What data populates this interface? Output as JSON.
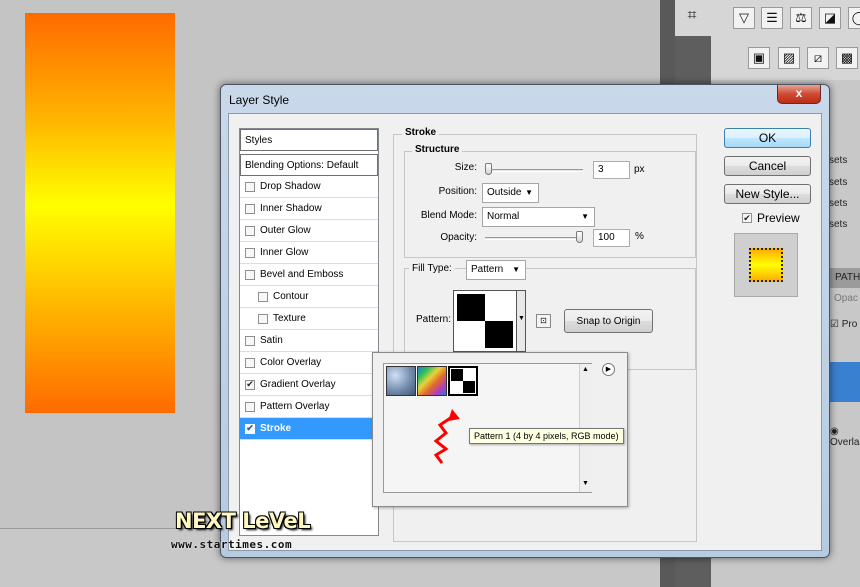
{
  "dialog": {
    "title": "Layer Style",
    "close_glyph": "x"
  },
  "styles": {
    "header": "Styles",
    "blending": "Blending Options: Default",
    "items": [
      {
        "label": "Drop Shadow",
        "checked": false
      },
      {
        "label": "Inner Shadow",
        "checked": false
      },
      {
        "label": "Outer Glow",
        "checked": false
      },
      {
        "label": "Inner Glow",
        "checked": false
      },
      {
        "label": "Bevel and Emboss",
        "checked": false
      },
      {
        "label": "Contour",
        "checked": false
      },
      {
        "label": "Texture",
        "checked": false
      },
      {
        "label": "Satin",
        "checked": false
      },
      {
        "label": "Color Overlay",
        "checked": false
      },
      {
        "label": "Gradient Overlay",
        "checked": true
      },
      {
        "label": "Pattern Overlay",
        "checked": false
      },
      {
        "label": "Stroke",
        "checked": true
      }
    ]
  },
  "stroke": {
    "title": "Stroke",
    "structure_title": "Structure",
    "size_label": "Size:",
    "size_value": "3",
    "size_unit": "px",
    "size_level": 0.0,
    "position_label": "Position:",
    "position_value": "Outside",
    "blend_label": "Blend Mode:",
    "blend_value": "Normal",
    "opacity_label": "Opacity:",
    "opacity_value": "100",
    "opacity_unit": "%",
    "opacity_level": 1.0,
    "fill_type_label": "Fill Type:",
    "fill_type_value": "Pattern",
    "pattern_label": "Pattern:",
    "snap_button": "Snap to Origin"
  },
  "buttons": {
    "ok": "OK",
    "cancel": "Cancel",
    "new_style": "New Style...",
    "preview_label": "Preview",
    "preview_checked": true
  },
  "pattern_picker": {
    "swatches": [
      "bubbles-pattern",
      "rainbow-pattern",
      "checker-pattern"
    ],
    "tooltip": "Pattern 1 (4 by 4 pixels, RGB mode)"
  },
  "side_panel": {
    "tab": "PATH",
    "snippets": [
      "sets",
      "sets",
      "sets",
      "sets",
      "Opac",
      "Pro",
      "Overla"
    ]
  },
  "watermark": {
    "title": "NEXT LeVeL",
    "url": "www.startimes.com"
  },
  "colors": {
    "selection": "#3399ff",
    "close_button": "#cf4a33",
    "gradient_orange": "#ff6a00",
    "gradient_yellow": "#ffff00"
  }
}
